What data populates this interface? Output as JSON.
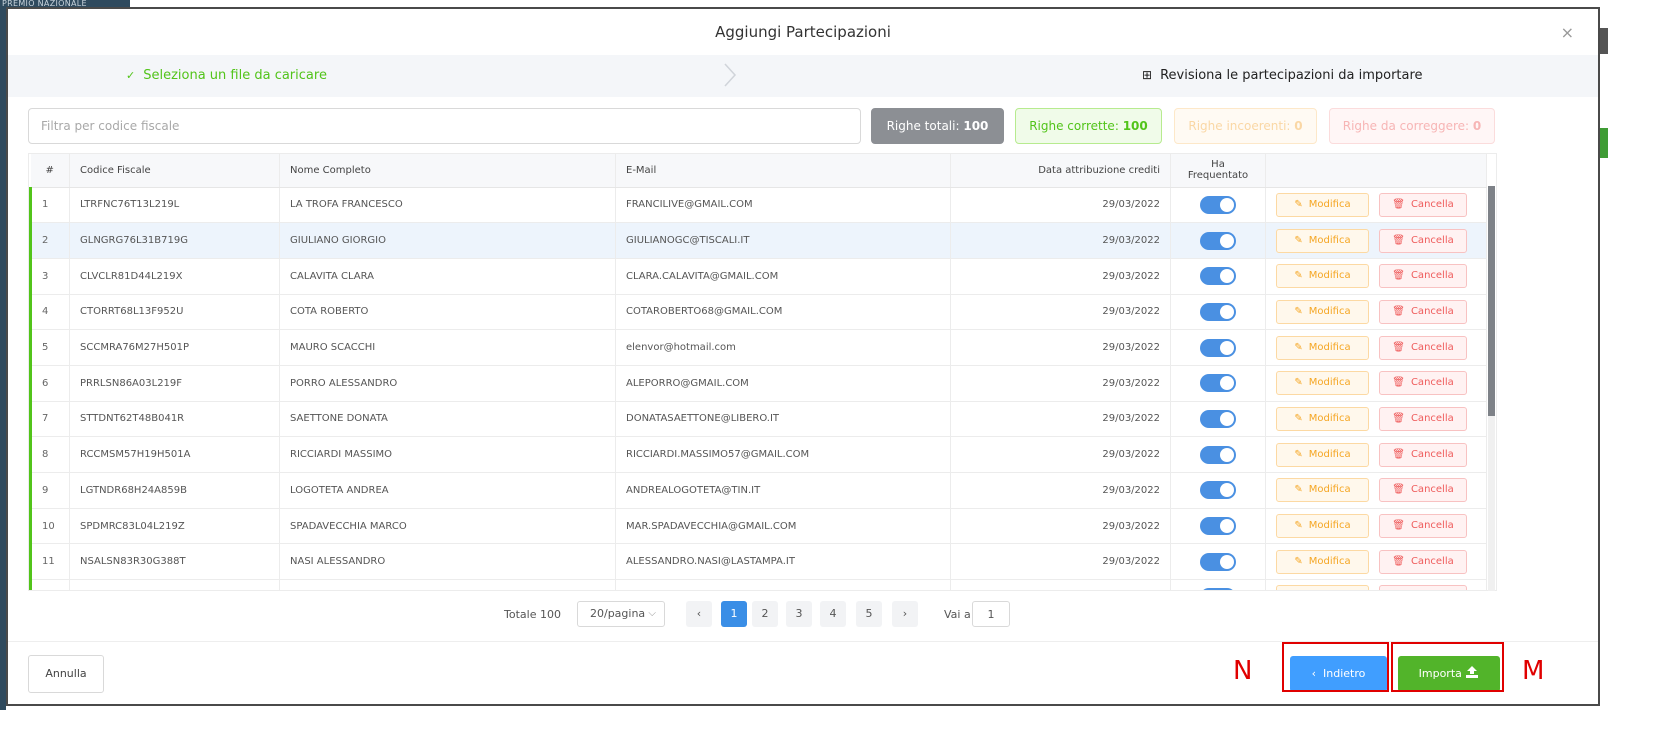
{
  "background": {
    "corner_text": "PREMIO NAZIONALE"
  },
  "modal": {
    "title": "Aggiungi Partecipazioni",
    "close_icon": "×"
  },
  "steps": {
    "step1": {
      "label": "Seleziona un file da caricare",
      "icon": "check-icon",
      "status": "done"
    },
    "step2": {
      "label": "Revisiona le partecipazioni da importare",
      "icon": "table-icon",
      "status": "active"
    }
  },
  "filter": {
    "placeholder": "Filtra per codice fiscale",
    "value": ""
  },
  "badges": {
    "total": {
      "label": "Righe totali:",
      "value": "100"
    },
    "correct": {
      "label": "Righe corrette:",
      "value": "100"
    },
    "incoherent": {
      "label": "Righe incoerenti:",
      "value": "0"
    },
    "to_fix": {
      "label": "Righe da correggere:",
      "value": "0"
    }
  },
  "table": {
    "columns": [
      "#",
      "Codice Fiscale",
      "Nome Completo",
      "E-Mail",
      "Data attribuzione crediti",
      "Ha Frequentato",
      ""
    ],
    "edit_label": "Modifica",
    "delete_label": "Cancella",
    "rows": [
      {
        "n": "1",
        "cf": "LTRFNC76T13L219L",
        "name": "LA TROFA FRANCESCO",
        "email": "FRANCILIVE@GMAIL.COM",
        "date": "29/03/2022",
        "attended": true
      },
      {
        "n": "2",
        "cf": "GLNGRG76L31B719G",
        "name": "GIULIANO GIORGIO",
        "email": "GIULIANOGC@TISCALI.IT",
        "date": "29/03/2022",
        "attended": true
      },
      {
        "n": "3",
        "cf": "CLVCLR81D44L219X",
        "name": "CALAVITA CLARA",
        "email": "CLARA.CALAVITA@GMAIL.COM",
        "date": "29/03/2022",
        "attended": true
      },
      {
        "n": "4",
        "cf": "CTORRT68L13F952U",
        "name": "COTA ROBERTO",
        "email": "COTAROBERTO68@GMAIL.COM",
        "date": "29/03/2022",
        "attended": true
      },
      {
        "n": "5",
        "cf": "SCCMRA76M27H501P",
        "name": "MAURO SCACCHI",
        "email": "elenvor@hotmail.com",
        "date": "29/03/2022",
        "attended": true
      },
      {
        "n": "6",
        "cf": "PRRLSN86A03L219F",
        "name": "PORRO ALESSANDRO",
        "email": "ALEPORRO@GMAIL.COM",
        "date": "29/03/2022",
        "attended": true
      },
      {
        "n": "7",
        "cf": "STTDNT62T48B041R",
        "name": "SAETTONE DONATA",
        "email": "DONATASAETTONE@LIBERO.IT",
        "date": "29/03/2022",
        "attended": true
      },
      {
        "n": "8",
        "cf": "RCCMSM57H19H501A",
        "name": "RICCIARDI MASSIMO",
        "email": "RICCIARDI.MASSIMO57@GMAIL.COM",
        "date": "29/03/2022",
        "attended": true
      },
      {
        "n": "9",
        "cf": "LGTNDR68H24A859B",
        "name": "LOGOTETA ANDREA",
        "email": "ANDREALOGOTETA@TIN.IT",
        "date": "29/03/2022",
        "attended": true
      },
      {
        "n": "10",
        "cf": "SPDMRC83L04L219Z",
        "name": "SPADAVECCHIA MARCO",
        "email": "MAR.SPADAVECCHIA@GMAIL.COM",
        "date": "29/03/2022",
        "attended": true
      },
      {
        "n": "11",
        "cf": "NSALSN83R30G388T",
        "name": "NASI ALESSANDRO",
        "email": "ALESSANDRO.NASI@LASTAMPA.IT",
        "date": "29/03/2022",
        "attended": true
      },
      {
        "n": "",
        "cf": "",
        "name": "",
        "email": "",
        "date": "",
        "attended": true
      }
    ]
  },
  "pagination": {
    "total_label": "Totale 100",
    "page_size": "20/pagina",
    "pages": [
      "1",
      "2",
      "3",
      "4",
      "5"
    ],
    "current_page": "1",
    "prev_icon": "‹",
    "next_icon": "›",
    "goto_label": "Vai a",
    "goto_value": "1"
  },
  "footer": {
    "cancel_label": "Annulla",
    "back_label": "Indietro",
    "back_icon": "chevron-left-icon",
    "import_label": "Importa",
    "import_icon": "upload-icon"
  },
  "annotations": {
    "n": "N",
    "m": "M",
    "color": "#e00000"
  },
  "colors": {
    "primary": "#409eff",
    "success": "#52b42a",
    "warning": "#f5a623",
    "danger": "#ef5b5b"
  }
}
